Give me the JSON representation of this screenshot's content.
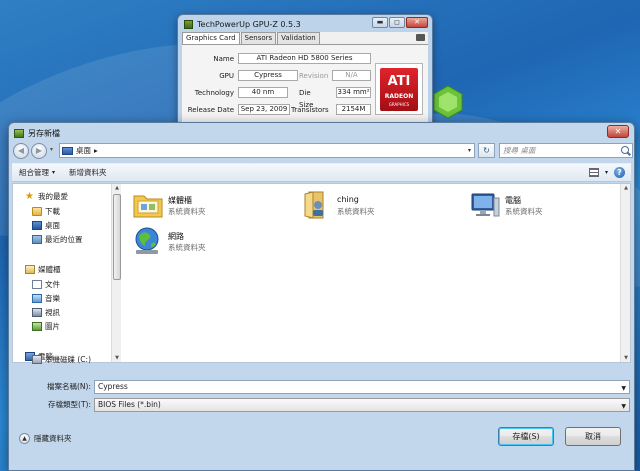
{
  "gpuz": {
    "title": "TechPowerUp GPU-Z 0.5.3",
    "tabs": [
      "Graphics Card",
      "Sensors",
      "Validation"
    ],
    "rows": {
      "name_label": "Name",
      "name_value": "ATI Radeon HD 5800 Series",
      "gpu_label": "GPU",
      "gpu_value": "Cypress",
      "revision_label": "Revision",
      "revision_value": "N/A",
      "tech_label": "Technology",
      "tech_value": "40 nm",
      "die_label": "Die Size",
      "die_value": "334 mm²",
      "release_label": "Release Date",
      "release_value": "Sep 23, 2009",
      "transistors_label": "Transistors",
      "transistors_value": "2154M"
    },
    "logo": {
      "brand": "ATI",
      "line": "RADEON",
      "tag": "GRAPHICS"
    },
    "window_buttons": {
      "minimize": "▬",
      "restore": "◻",
      "close": "✕"
    }
  },
  "dialog": {
    "title": "另存新檔",
    "close": "✕",
    "nav": {
      "back": "◀",
      "forward": "▶",
      "dropdown": "▾",
      "refresh": "↻"
    },
    "address": {
      "location": "桌面",
      "separator": "▸",
      "dropdown": "▾"
    },
    "search": {
      "placeholder": "搜尋 桌面"
    },
    "toolbar": {
      "organize": "組合管理",
      "organize_arrow": "▾",
      "new_folder": "新增資料夾",
      "view_arrow": "▾",
      "help": "?"
    },
    "sidebar": {
      "favorites": "我的最愛",
      "downloads": "下載",
      "desktop": "桌面",
      "recent": "最近的位置",
      "libraries": "媒體櫃",
      "documents": "文件",
      "music": "音樂",
      "videos": "視訊",
      "pictures": "圖片",
      "computer": "電腦",
      "local_disk": "本機磁碟 (C:)"
    },
    "files": [
      {
        "name": "媒體櫃",
        "type": "系統資料夾"
      },
      {
        "name": "ching",
        "type": "系統資料夾"
      },
      {
        "name": "電腦",
        "type": "系統資料夾"
      },
      {
        "name": "網路",
        "type": "系統資料夾"
      }
    ],
    "form": {
      "filename_label": "檔案名稱(N):",
      "filename_value": "Cypress",
      "filetype_label": "存檔類型(T):",
      "filetype_value": "BIOS Files (*.bin)"
    },
    "footer": {
      "hide_folders": "隱藏資料夾",
      "save": "存檔(S)",
      "cancel": "取消"
    }
  }
}
